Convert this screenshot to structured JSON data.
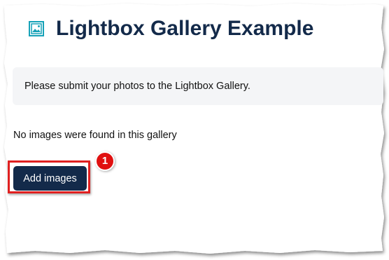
{
  "page": {
    "title": "Lightbox Gallery Example",
    "title_icon": "image-icon"
  },
  "notice": {
    "text": "Please submit your photos to the Lightbox Gallery."
  },
  "gallery": {
    "empty_message": "No images were found in this gallery"
  },
  "actions": {
    "add_images_label": "Add images"
  },
  "annotation": {
    "step_number": "1",
    "highlight_color": "#e02020"
  },
  "colors": {
    "title": "#132a4a",
    "button_bg": "#132a4a",
    "icon_accent": "#17a2b8"
  }
}
